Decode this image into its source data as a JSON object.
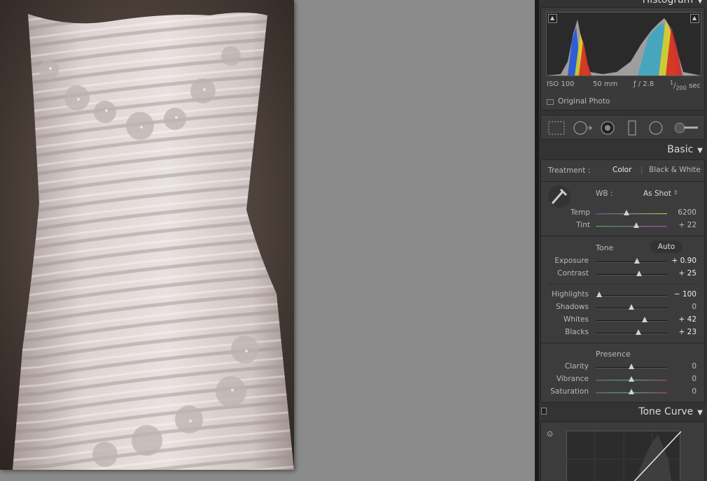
{
  "histogram": {
    "title": "Histogram",
    "iso": "ISO 100",
    "focal_length": "50 mm",
    "aperture": "ƒ / 2.8",
    "shutter_num": "1",
    "shutter_den": "200",
    "shutter_unit": "sec",
    "original_photo_label": "Original Photo"
  },
  "tools": [
    "crop-overlay",
    "spot-removal",
    "red-eye-correction",
    "graduated-filter",
    "radial-filter",
    "adjustment-brush"
  ],
  "basic": {
    "title": "Basic",
    "treatment_label": "Treatment :",
    "treatment_color": "Color",
    "treatment_bw": "Black & White",
    "wb_label": "WB :",
    "wb_value": "As Shot",
    "tone_label": "Tone",
    "auto_label": "Auto",
    "presence_label": "Presence",
    "sliders": {
      "temp": {
        "label": "Temp",
        "value": "6200",
        "pos": 0.43
      },
      "tint": {
        "label": "Tint",
        "value": "+ 22",
        "pos": 0.57
      },
      "exposure": {
        "label": "Exposure",
        "value": "+ 0.90",
        "pos": 0.58
      },
      "contrast": {
        "label": "Contrast",
        "value": "+ 25",
        "pos": 0.61
      },
      "highlights": {
        "label": "Highlights",
        "value": "− 100",
        "pos": 0.05
      },
      "shadows": {
        "label": "Shadows",
        "value": "0",
        "pos": 0.5
      },
      "whites": {
        "label": "Whites",
        "value": "+ 42",
        "pos": 0.69
      },
      "blacks": {
        "label": "Blacks",
        "value": "+ 23",
        "pos": 0.6
      },
      "clarity": {
        "label": "Clarity",
        "value": "0",
        "pos": 0.5
      },
      "vibrance": {
        "label": "Vibrance",
        "value": "0",
        "pos": 0.5
      },
      "saturation": {
        "label": "Saturation",
        "value": "0",
        "pos": 0.5
      }
    }
  },
  "tone_curve": {
    "title": "Tone Curve"
  },
  "colors": {
    "panel_bg": "#333333",
    "box_bg": "#3c3c3c",
    "canvas_bg": "#8b8b8b"
  }
}
